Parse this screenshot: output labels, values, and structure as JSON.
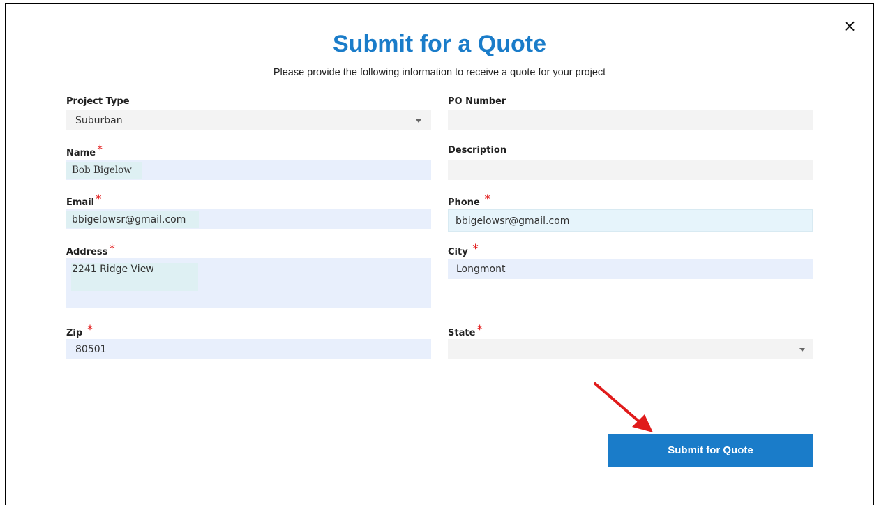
{
  "dialog": {
    "title": "Submit for a Quote",
    "subtitle": "Please provide the following information to receive a quote for your project",
    "close_icon": "×"
  },
  "fields": {
    "project_type": {
      "label": "Project Type",
      "value": "Suburban"
    },
    "po_number": {
      "label": "PO Number",
      "value": ""
    },
    "name": {
      "label": "Name",
      "required": "*",
      "value": "Bob Bigelow"
    },
    "description": {
      "label": "Description",
      "value": ""
    },
    "email": {
      "label": "Email",
      "required": "*",
      "value": "bbigelowsr@gmail.com"
    },
    "phone": {
      "label": "Phone",
      "required": "*",
      "value": "bbigelowsr@gmail.com"
    },
    "address": {
      "label": "Address",
      "required": "*",
      "value": "2241 Ridge View"
    },
    "city": {
      "label": "City",
      "required": "*",
      "value": "Longmont"
    },
    "zip": {
      "label": "Zip",
      "required": "*",
      "value": "80501"
    },
    "state": {
      "label": "State",
      "required": "*",
      "value": ""
    }
  },
  "submit_button": {
    "label": "Submit for Quote"
  },
  "colors": {
    "accent": "#1a7cc9",
    "required": "#e21b1b",
    "annotation_arrow": "#e01b1b"
  }
}
